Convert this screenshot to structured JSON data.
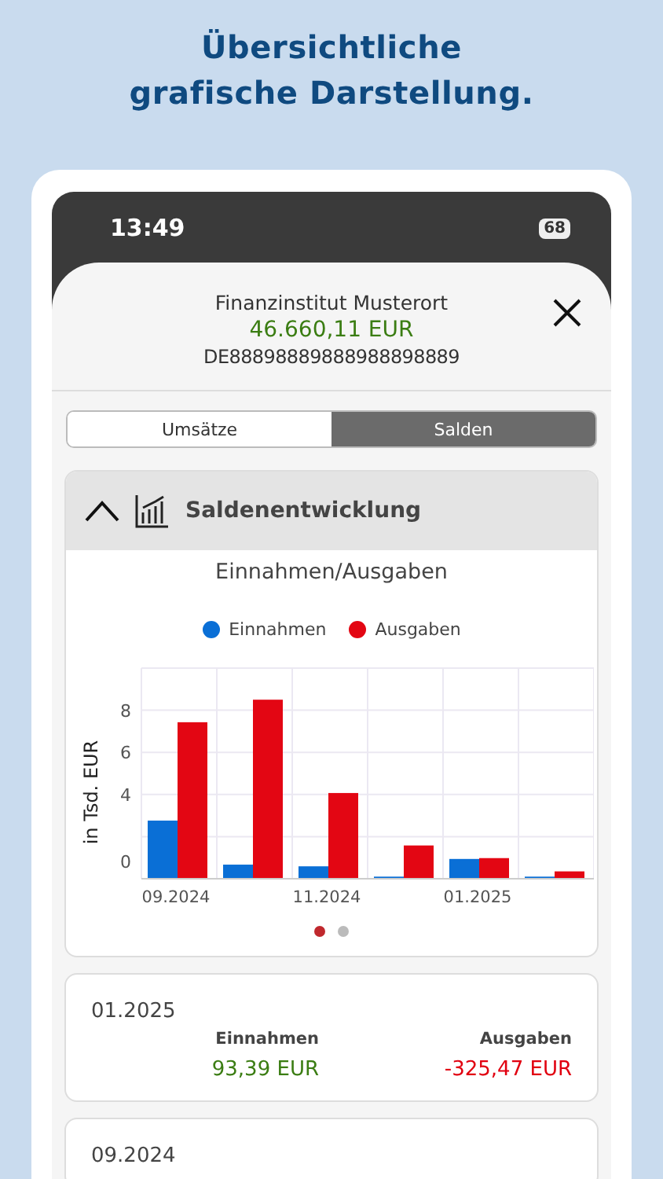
{
  "headline": "Übersichtliche grafische Darstellung.",
  "status_bar": {
    "time": "13:49",
    "battery": "68"
  },
  "account": {
    "bank": "Finanzinstitut Musterort",
    "balance": "46.660,11 EUR",
    "iban": "DE88898889888988898889"
  },
  "tabs": [
    {
      "label": "Umsätze",
      "selected": false
    },
    {
      "label": "Salden",
      "selected": true
    }
  ],
  "panel": {
    "title": "Saldenentwicklung",
    "expanded": true,
    "chart_data": {
      "type": "bar",
      "title": "Einnahmen/Ausgaben",
      "ylabel": "in Tsd. EUR",
      "categories": [
        "09.2024",
        null,
        "11.2024",
        null,
        "01.2025",
        null
      ],
      "ylim": [
        0,
        10
      ],
      "yticks": [
        0,
        4,
        6,
        8
      ],
      "grid": true,
      "legend": "top",
      "series": [
        {
          "name": "Einnahmen",
          "color": "#0a6fd6",
          "values": [
            2.76,
            0.67,
            0.59,
            0.1,
            0.94,
            0.1
          ]
        },
        {
          "name": "Ausgaben",
          "color": "#e30613",
          "values": [
            7.43,
            8.5,
            4.07,
            1.58,
            0.98,
            0.35
          ]
        }
      ]
    },
    "pages": [
      {
        "selected": true
      },
      {
        "selected": false
      }
    ]
  },
  "months": [
    {
      "date": "01.2025",
      "income_label": "Einnahmen",
      "income": "93,39 EUR",
      "expense_label": "Ausgaben",
      "expense": "-325,47 EUR"
    },
    {
      "date": "09.2024"
    }
  ]
}
